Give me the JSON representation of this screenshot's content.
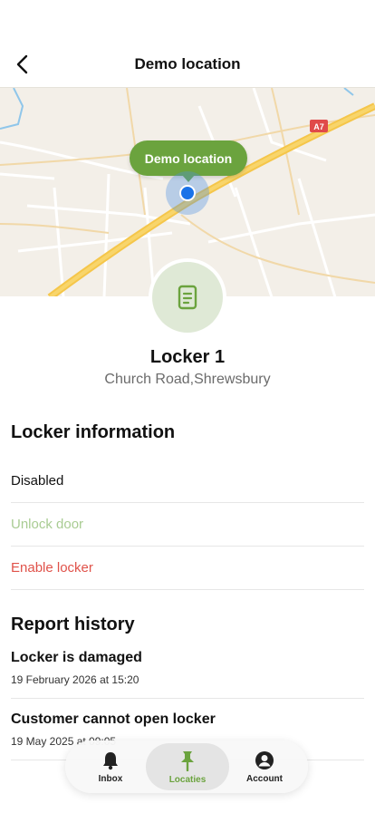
{
  "header": {
    "title": "Demo location"
  },
  "map": {
    "tooltip": "Demo location",
    "road_label": "A7"
  },
  "locker": {
    "name": "Locker 1",
    "address": "Church Road,Shrewsbury"
  },
  "locker_info": {
    "title": "Locker information",
    "status": "Disabled",
    "unlock_label": "Unlock door",
    "enable_label": "Enable locker"
  },
  "report_history": {
    "title": "Report history",
    "items": [
      {
        "title": "Locker is damaged",
        "date": "19 February 2026 at 15:20"
      },
      {
        "title": "Customer cannot open locker",
        "date": "19 May 2025 at 09:05"
      }
    ]
  },
  "tabbar": {
    "inbox": "Inbox",
    "locaties": "Locaties",
    "account": "Account"
  },
  "colors": {
    "brand_green": "#6ba33e",
    "danger_red": "#e0524a",
    "muted_green": "#a9cc93",
    "pin_blue": "#1a73e8"
  },
  "icons": {
    "back": "chevron-left-icon",
    "locker": "locker-icon",
    "inbox": "bell-icon",
    "locaties": "pin-icon",
    "account": "user-icon"
  }
}
